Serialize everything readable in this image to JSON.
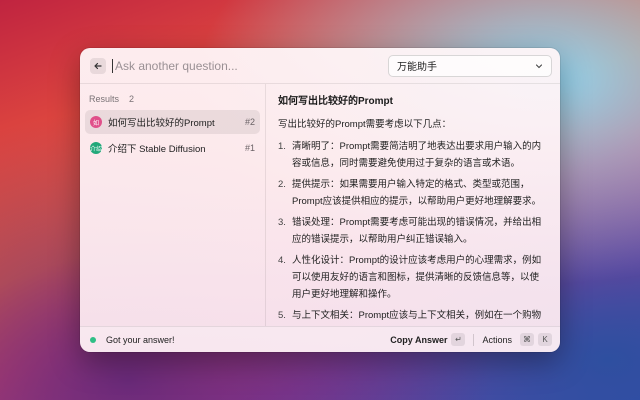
{
  "header": {
    "search_placeholder": "Ask another question...",
    "assistant_select": "万能助手"
  },
  "sidebar": {
    "title": "Results",
    "count": "2",
    "items": [
      {
        "icon_text": "如",
        "icon_color": "#e0508a",
        "label": "如何写出比较好的Prompt",
        "shortcut": "#2"
      },
      {
        "icon_text": "介绍",
        "icon_color": "#22a87a",
        "label": "介绍下 Stable Diffusion",
        "shortcut": "#1"
      }
    ]
  },
  "content": {
    "title": "如何写出比较好的Prompt",
    "intro": "写出比较好的Prompt需要考虑以下几点：",
    "items": [
      {
        "num": "1.",
        "text": "清晰明了：Prompt需要简洁明了地表达出要求用户输入的内容或信息，同时需要避免使用过于复杂的语言或术语。"
      },
      {
        "num": "2.",
        "text": "提供提示：如果需要用户输入特定的格式、类型或范围，Prompt应该提供相应的提示，以帮助用户更好地理解要求。"
      },
      {
        "num": "3.",
        "text": "错误处理：Prompt需要考虑可能出现的错误情况，并给出相应的错误提示，以帮助用户纠正错误输入。"
      },
      {
        "num": "4.",
        "text": "人性化设计：Prompt的设计应该考虑用户的心理需求，例如可以使用友好的语言和图标，提供清晰的反馈信息等，以使用户更好地理解和操作。"
      },
      {
        "num": "5.",
        "text": "与上下文相关：Prompt应该与上下文相关，例如在一个购物网站中，Prompt需要与购物相关的信息，而不是与其他无关的信息。"
      }
    ]
  },
  "footer": {
    "status": "Got your answer!",
    "copy_label": "Copy Answer",
    "copy_key": "↵",
    "actions_label": "Actions",
    "actions_key1": "⌘",
    "actions_key2": "K"
  }
}
